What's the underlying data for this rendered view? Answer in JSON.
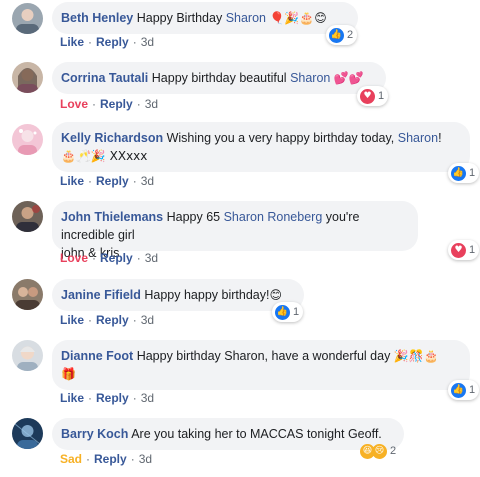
{
  "comments": [
    {
      "author": "Beth Henley",
      "text_before": "Happy Birthday",
      "mention": "Sharon",
      "text_after": "",
      "emojis": "🎈🎉🎂😊",
      "second_line": "",
      "reaction_action": "Like",
      "reply_label": "Reply",
      "time": "3d",
      "reaction_icons": [
        "like-icon",
        "love-icon"
      ],
      "reaction_count": "2"
    },
    {
      "author": "Corrina Tautali",
      "text_before": "Happy birthday beautiful",
      "mention": "Sharon",
      "text_after": "",
      "emojis": "💕💕",
      "second_line": "",
      "reaction_action": "Love",
      "reply_label": "Reply",
      "time": "3d",
      "reaction_icons": [
        "love-icon"
      ],
      "reaction_count": "1"
    },
    {
      "author": "Kelly Richardson",
      "text_before": "Wishing you a very happy birthday today,",
      "mention": "Sharon",
      "text_after": "!",
      "emojis": "",
      "second_line": "🎂🥂🎉 XXxxx",
      "reaction_action": "Like",
      "reply_label": "Reply",
      "time": "3d",
      "reaction_icons": [
        "like-icon"
      ],
      "reaction_count": "1"
    },
    {
      "author": "John Thielemans",
      "text_before": "Happy 65",
      "mention": "Sharon Roneberg",
      "text_after": "you're incredible girl",
      "emojis": "",
      "second_line": "john & kris",
      "reaction_action": "Love",
      "reply_label": "Reply",
      "time": "3d",
      "reaction_icons": [
        "love-icon"
      ],
      "reaction_count": "1"
    },
    {
      "author": "Janine Fifield",
      "text_before": "Happy happy birthday!",
      "mention": "",
      "text_after": "",
      "emojis": "😊",
      "second_line": "",
      "reaction_action": "Like",
      "reply_label": "Reply",
      "time": "3d",
      "reaction_icons": [
        "like-icon"
      ],
      "reaction_count": "1"
    },
    {
      "author": "Dianne Foot",
      "text_before": "Happy birthday Sharon, have a wonderful day",
      "mention": "",
      "text_after": "",
      "emojis": "🎉🎊🎂",
      "second_line": "🎁",
      "reaction_action": "Like",
      "reply_label": "Reply",
      "time": "3d",
      "reaction_icons": [
        "like-icon"
      ],
      "reaction_count": "1"
    },
    {
      "author": "Barry Koch",
      "text_before": "Are you taking her to MACCAS tonight Geoff.",
      "mention": "",
      "text_after": "",
      "emojis": "",
      "second_line": "",
      "reaction_action": "Sad",
      "reply_label": "Reply",
      "time": "3d",
      "reaction_icons": [
        "haha-icon",
        "sad-icon"
      ],
      "reaction_count": "2"
    }
  ],
  "colors": {
    "name": "#385898",
    "love": "#e8405c",
    "like": "#1877f2",
    "sad": "#f7b125",
    "bubble": "#f2f3f5",
    "meta": "#606770"
  }
}
